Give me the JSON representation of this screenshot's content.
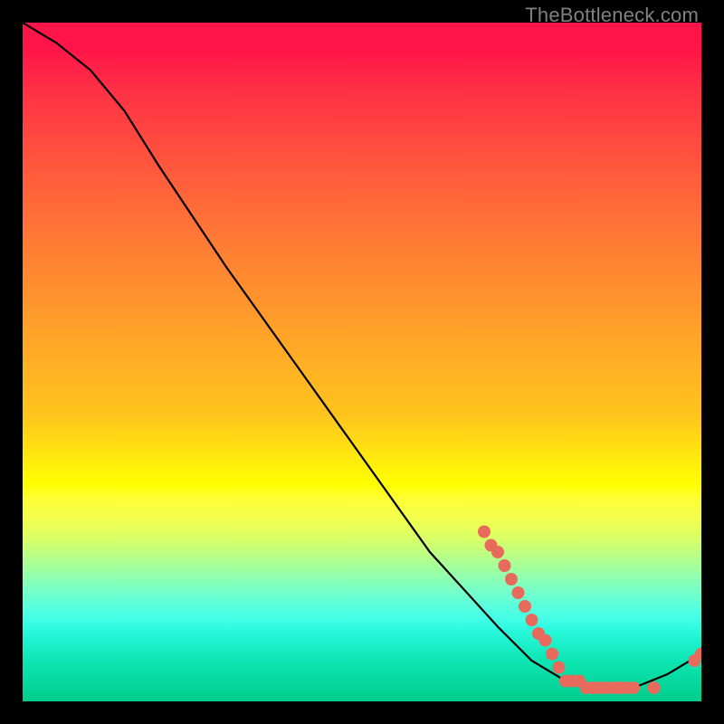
{
  "attribution": "TheBottleneck.com",
  "chart_data": {
    "type": "line",
    "title": "",
    "xlabel": "",
    "ylabel": "",
    "xlim": [
      0,
      100
    ],
    "ylim": [
      0,
      100
    ],
    "curve": [
      {
        "x": 0,
        "y": 100
      },
      {
        "x": 5,
        "y": 97
      },
      {
        "x": 10,
        "y": 93
      },
      {
        "x": 15,
        "y": 87
      },
      {
        "x": 20,
        "y": 79
      },
      {
        "x": 30,
        "y": 64
      },
      {
        "x": 40,
        "y": 50
      },
      {
        "x": 50,
        "y": 36
      },
      {
        "x": 60,
        "y": 22
      },
      {
        "x": 70,
        "y": 11
      },
      {
        "x": 75,
        "y": 6
      },
      {
        "x": 80,
        "y": 3
      },
      {
        "x": 85,
        "y": 2
      },
      {
        "x": 90,
        "y": 2
      },
      {
        "x": 95,
        "y": 4
      },
      {
        "x": 100,
        "y": 7
      }
    ],
    "points": [
      {
        "x": 68,
        "y": 25
      },
      {
        "x": 69,
        "y": 23
      },
      {
        "x": 70,
        "y": 22
      },
      {
        "x": 71,
        "y": 20
      },
      {
        "x": 72,
        "y": 18
      },
      {
        "x": 73,
        "y": 16
      },
      {
        "x": 74,
        "y": 14
      },
      {
        "x": 75,
        "y": 12
      },
      {
        "x": 76,
        "y": 10
      },
      {
        "x": 77,
        "y": 9
      },
      {
        "x": 78,
        "y": 7
      },
      {
        "x": 79,
        "y": 5
      },
      {
        "x": 80,
        "y": 3
      },
      {
        "x": 81,
        "y": 3
      },
      {
        "x": 82,
        "y": 3
      },
      {
        "x": 83,
        "y": 2
      },
      {
        "x": 84,
        "y": 2
      },
      {
        "x": 85,
        "y": 2
      },
      {
        "x": 86,
        "y": 2
      },
      {
        "x": 87,
        "y": 2
      },
      {
        "x": 88,
        "y": 2
      },
      {
        "x": 89,
        "y": 2
      },
      {
        "x": 90,
        "y": 2
      },
      {
        "x": 93,
        "y": 2
      },
      {
        "x": 99,
        "y": 6
      },
      {
        "x": 100,
        "y": 7
      }
    ],
    "colors": {
      "curve": "#000000",
      "points": "#e86a5c"
    }
  }
}
